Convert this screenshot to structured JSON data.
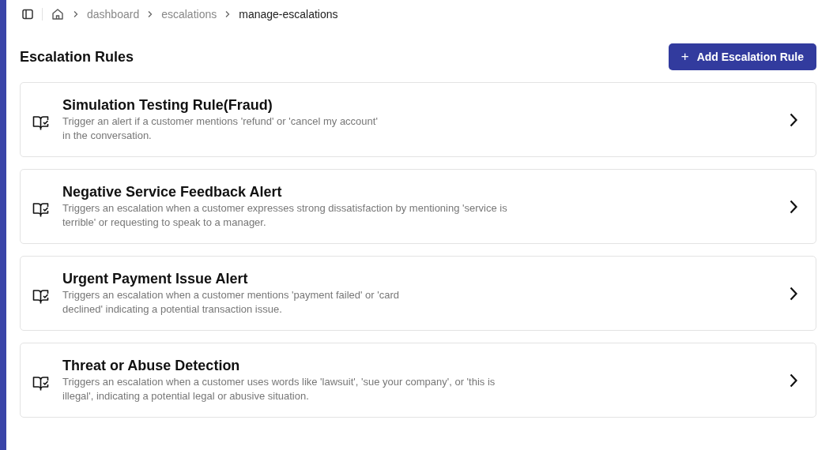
{
  "breadcrumb": [
    {
      "label": "dashboard",
      "current": false
    },
    {
      "label": "escalations",
      "current": false
    },
    {
      "label": "manage-escalations",
      "current": true
    }
  ],
  "page_title": "Escalation Rules",
  "add_button": {
    "icon": "+",
    "label": "Add Escalation Rule"
  },
  "rules": [
    {
      "title": "Simulation Testing Rule(Fraud)",
      "description": "Trigger an alert if a customer mentions 'refund' or 'cancel my account' in the conversation."
    },
    {
      "title": "Negative Service Feedback Alert",
      "description": "Triggers an escalation when a customer expresses strong dissatisfaction by mentioning 'service is terrible' or requesting to speak to a manager."
    },
    {
      "title": "Urgent Payment Issue Alert",
      "description": "Triggers an escalation when a customer mentions 'payment failed' or 'card declined' indicating a potential transaction issue."
    },
    {
      "title": "Threat or Abuse Detection",
      "description": "Triggers an escalation when a customer uses words like 'lawsuit', 'sue your company', or 'this is illegal', indicating a potential legal or abusive situation."
    }
  ]
}
